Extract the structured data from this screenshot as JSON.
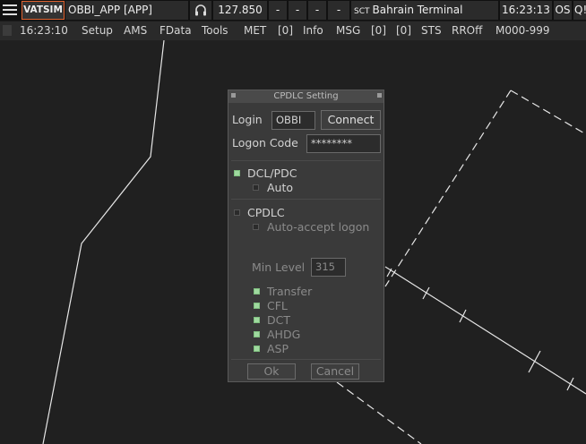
{
  "topbar": {
    "network": "VATSIM",
    "callsign": "OBBI_APP [APP]",
    "frequency": "127.850",
    "slots": [
      "-",
      "-",
      "-",
      "-"
    ],
    "sct_label": "SCT",
    "sector": "Bahrain Terminal",
    "utc_time": "16:23:13",
    "os_label": "OS",
    "qs_label": "Q!"
  },
  "menubar": {
    "time": "16:23:10",
    "items": [
      "Setup",
      "AMS",
      "FData",
      "Tools",
      "MET",
      "[0]",
      "Info",
      "MSG",
      "[0]",
      "[0]",
      "STS",
      "RROff",
      "M000-999"
    ]
  },
  "dialog": {
    "title": "CPDLC Setting",
    "login_label": "Login",
    "login_value": "OBBI",
    "connect_label": "Connect",
    "logon_code_label": "Logon Code",
    "logon_code_value": "********",
    "dcl_pdc_label": "DCL/PDC",
    "auto_label": "Auto",
    "cpdlc_label": "CPDLC",
    "auto_accept_label": "Auto-accept logon",
    "min_level_label": "Min Level",
    "min_level_value": "315",
    "options": [
      "Transfer",
      "CFL",
      "DCT",
      "AHDG",
      "ASP"
    ],
    "ok_label": "Ok",
    "cancel_label": "Cancel"
  },
  "colors": {
    "accent_checked": "#9fd99f",
    "network_border": "#e0622f",
    "scope_background": "#202020"
  }
}
